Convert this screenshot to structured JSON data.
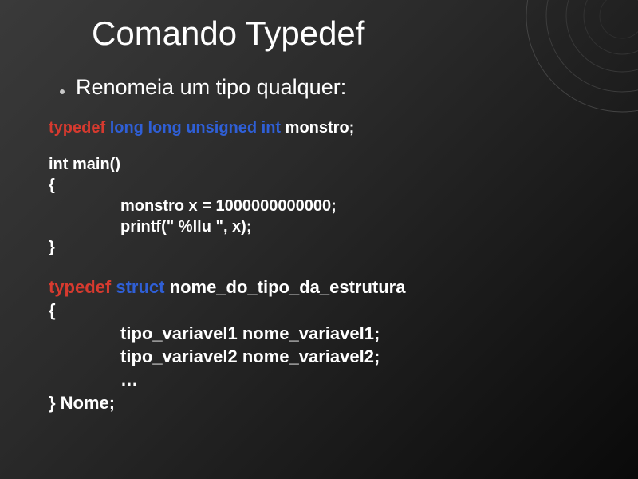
{
  "title": "Comando Typedef",
  "bullet": "Renomeia um tipo qualquer:",
  "code1": {
    "typedef": "typedef",
    "types": "long long unsigned int",
    "name": "monstro;"
  },
  "code2": {
    "sig": "int main()",
    "open": "{",
    "l1": "monstro x = 1000000000000;",
    "l2": "printf(\" %llu \", x);",
    "close": "}"
  },
  "code3": {
    "typedef": "typedef",
    "struct": "struct",
    "structname": "nome_do_tipo_da_estrutura",
    "open": "{",
    "l1": "tipo_variavel1 nome_variavel1;",
    "l2": "tipo_variavel2 nome_variavel2;",
    "l3": "…",
    "close": "} Nome;"
  }
}
